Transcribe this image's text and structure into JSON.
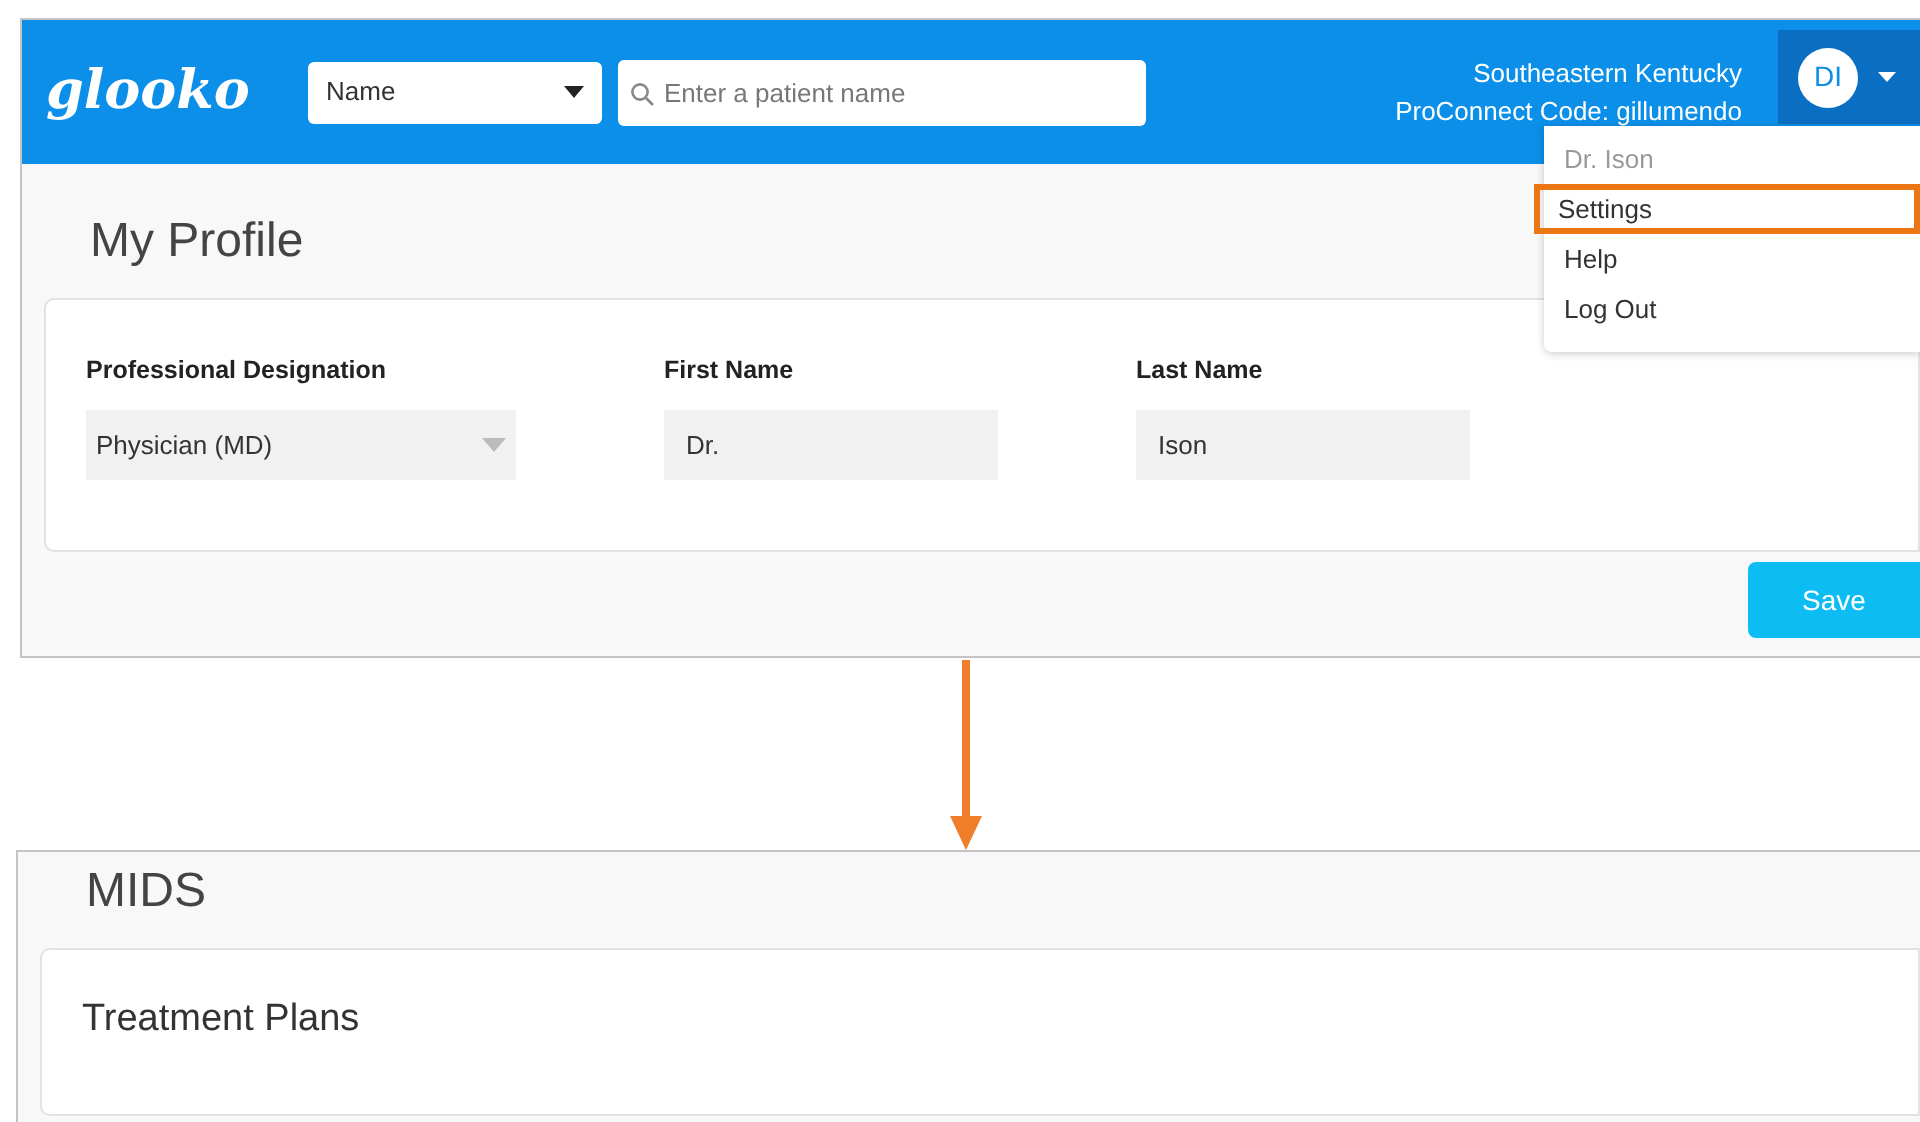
{
  "top_screen": {
    "logo": "glooko",
    "search_type": {
      "value": "Name"
    },
    "search": {
      "placeholder": "Enter a patient name"
    },
    "organization": "Southeastern Kentucky",
    "proconnect": "ProConnect Code: gillumendo",
    "avatar": "DI",
    "user_menu": {
      "expanded": true,
      "items": [
        {
          "label": "Dr. Ison",
          "disabled": true,
          "selected": false
        },
        {
          "label": "Settings",
          "disabled": false,
          "selected": true
        },
        {
          "label": "Help",
          "disabled": false,
          "selected": false
        },
        {
          "label": "Log Out",
          "disabled": false,
          "selected": false
        }
      ]
    },
    "page_title": "My Profile",
    "fields": [
      {
        "kind": "select",
        "label": "Professional Designation",
        "value": "Physician (MD)"
      },
      {
        "kind": "text",
        "label": "First Name",
        "value": "Dr."
      },
      {
        "kind": "text",
        "label": "Last Name",
        "value": "Ison"
      }
    ],
    "save_button": "Save"
  },
  "bottom_screen": {
    "page_title": "MIDS",
    "card_title": "Treatment Plans"
  }
}
